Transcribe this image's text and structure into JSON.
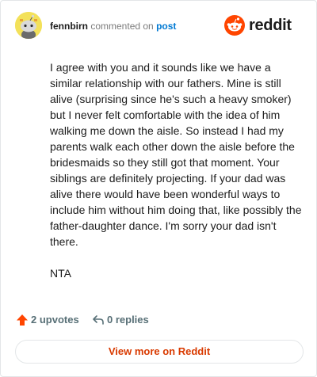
{
  "header": {
    "username": "fennbirn",
    "action_text": "commented on",
    "post_link": "post",
    "brand_wordmark": "reddit"
  },
  "comment": {
    "paragraphs": [
      "I agree with you and it sounds like we have a similar relationship with our fathers. Mine is still alive (surprising since he's such a heavy smoker) but I never felt comfortable with the idea of him walking me down the aisle. So instead I had my parents walk each other down the aisle before the bridesmaids so they still got that moment. Your siblings are definitely projecting. If your dad was alive there would have been wonderful ways to include him without him doing that, like possibly the father-daughter dance. I'm sorry your dad isn't there.",
      "NTA"
    ]
  },
  "actions": {
    "upvotes_label": "2 upvotes",
    "replies_label": "0 replies",
    "upvote_icon": "upvote-arrow-icon",
    "reply_icon": "reply-icon"
  },
  "footer": {
    "view_more_label": "View more on Reddit"
  },
  "colors": {
    "brand_orange": "#ff4500",
    "link_blue": "#0079d3",
    "view_more_text": "#d93a00",
    "muted_text": "#576f76",
    "avatar_bg": "#f3e15a"
  }
}
